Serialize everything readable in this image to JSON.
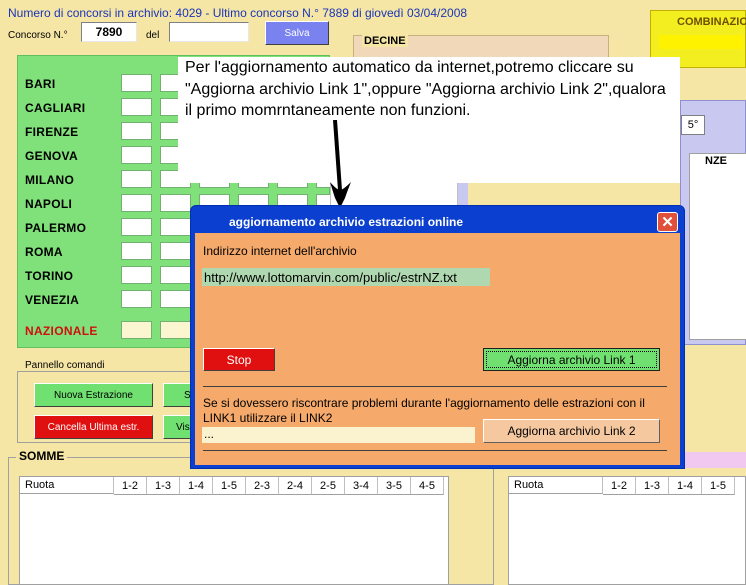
{
  "header": {
    "archive_count": "Numero di concorsi in archivio: 4029   -   Ultimo concorso N.° 7889   di giovedì 03/04/2008",
    "concorso_label": "Concorso N.°",
    "concorso_value": "7890",
    "del_label": "del",
    "del_value": "",
    "save_label": "Salva"
  },
  "cities": [
    "BARI",
    "CAGLIARI",
    "FIRENZE",
    "GENOVA",
    "MILANO",
    "NAPOLI",
    "PALERMO",
    "ROMA",
    "TORINO",
    "VENEZIA"
  ],
  "nazionale_label": "NAZIONALE",
  "decine_label": "DECINE",
  "combinazione_label": "COMBINAZIO",
  "partial_right": {
    "cell_label": "5°",
    "section_label": "NZE"
  },
  "note": "Per l'aggiornamento automatico da internet,potremo cliccare su \"Aggiorna archivio Link 1\",oppure \"Aggiorna archivio Link 2\",qualora il primo momrntaneamente non funzioni.",
  "pannello": {
    "title": "Pannello comandi",
    "nuova_estrazione": "Nuova Estrazione",
    "cancella_ultima": "Cancella Ultima estr.",
    "partial_btn1": "S",
    "partial_btn2": "Vis"
  },
  "dialog": {
    "title": "aggiornamento archivio estrazioni online",
    "url_label": "Indirizzo internet dell'archivio",
    "url_value": "http://www.lottomarvin.com/public/estrNZ.txt",
    "stop_label": "Stop",
    "link1_label": "Aggiorna archivio Link 1",
    "problem_text": "Se si dovessero riscontrare problemi durante l'aggiornamento delle estrazioni con il LINK1 utilizzare il LINK2",
    "link2_field_value": "...",
    "link2_label": "Aggiorna archivio Link 2"
  },
  "somme": {
    "title": "SOMME",
    "columns": [
      "Ruota",
      "1-2",
      "1-3",
      "1-4",
      "1-5",
      "2-3",
      "2-4",
      "2-5",
      "3-4",
      "3-5",
      "4-5"
    ],
    "right_columns": [
      "Ruota",
      "1-2",
      "1-3",
      "1-4",
      "1-5"
    ]
  },
  "colors": {
    "background": "#f5e6a6",
    "title_blue": "#1a35b8",
    "green_panel": "#80e07a",
    "dialog_body": "#f5a96a",
    "dialog_titlebar": "#0a3fd0",
    "stop_red": "#e01010",
    "link1_green": "#70e070",
    "nazionale_red": "#d01010"
  },
  "icons": [
    "close-icon",
    "arrow-pointer-icon"
  ]
}
